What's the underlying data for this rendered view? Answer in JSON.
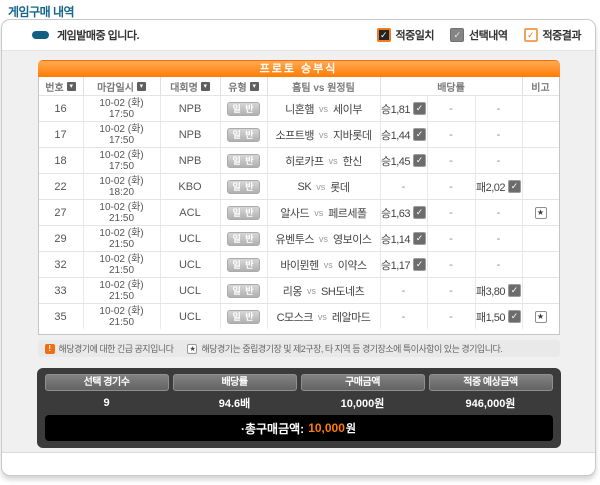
{
  "page": {
    "title": "게임구매 내역"
  },
  "status": {
    "message": "게임발매중 입니다.",
    "legend": [
      {
        "label": "적중일치",
        "style": "dark"
      },
      {
        "label": "선택내역",
        "style": "gray"
      },
      {
        "label": "적중결과",
        "style": "outline"
      }
    ]
  },
  "icons": {
    "check": "✓",
    "star": "★",
    "alert": "!",
    "sort": "▾"
  },
  "table": {
    "title": "프로토 승부식",
    "vs_label": "vs",
    "columns": [
      {
        "label": "번호",
        "sortable": true
      },
      {
        "label": "마감일시",
        "sortable": true
      },
      {
        "label": "대회명",
        "sortable": true
      },
      {
        "label": "유형",
        "sortable": true
      },
      {
        "label": "홈팀 vs 원정팀",
        "sortable": false
      },
      {
        "label": "배당률",
        "sortable": false
      },
      {
        "label": "비고",
        "sortable": false
      }
    ],
    "rows": [
      {
        "no": "16",
        "date": "10-02 (화)",
        "time": "17:50",
        "league": "NPB",
        "type": "일 반",
        "home": "니혼햄",
        "away": "세이부",
        "odds": [
          {
            "text": "승1,81",
            "checked": true
          },
          {
            "text": "-",
            "checked": false
          },
          {
            "text": "-",
            "checked": false
          }
        ],
        "star": false
      },
      {
        "no": "17",
        "date": "10-02 (화)",
        "time": "17:50",
        "league": "NPB",
        "type": "일 반",
        "home": "소프트뱅",
        "away": "지바롯데",
        "odds": [
          {
            "text": "승1,44",
            "checked": true
          },
          {
            "text": "-",
            "checked": false
          },
          {
            "text": "-",
            "checked": false
          }
        ],
        "star": false
      },
      {
        "no": "18",
        "date": "10-02 (화)",
        "time": "17:50",
        "league": "NPB",
        "type": "일 반",
        "home": "히로카프",
        "away": "한신",
        "odds": [
          {
            "text": "승1,45",
            "checked": true
          },
          {
            "text": "-",
            "checked": false
          },
          {
            "text": "-",
            "checked": false
          }
        ],
        "star": false
      },
      {
        "no": "22",
        "date": "10-02 (화)",
        "time": "18:20",
        "league": "KBO",
        "type": "일 반",
        "home": "SK",
        "away": "롯데",
        "odds": [
          {
            "text": "-",
            "checked": false
          },
          {
            "text": "-",
            "checked": false
          },
          {
            "text": "패2,02",
            "checked": true
          }
        ],
        "star": false
      },
      {
        "no": "27",
        "date": "10-02 (화)",
        "time": "21:50",
        "league": "ACL",
        "type": "일 반",
        "home": "알사드",
        "away": "페르세폴",
        "odds": [
          {
            "text": "승1,63",
            "checked": true
          },
          {
            "text": "-",
            "checked": false
          },
          {
            "text": "-",
            "checked": false
          }
        ],
        "star": true
      },
      {
        "no": "29",
        "date": "10-02 (화)",
        "time": "21:50",
        "league": "UCL",
        "type": "일 반",
        "home": "유벤투스",
        "away": "영보이스",
        "odds": [
          {
            "text": "승1,14",
            "checked": true
          },
          {
            "text": "-",
            "checked": false
          },
          {
            "text": "-",
            "checked": false
          }
        ],
        "star": false
      },
      {
        "no": "32",
        "date": "10-02 (화)",
        "time": "21:50",
        "league": "UCL",
        "type": "일 반",
        "home": "바이뮌헨",
        "away": "이약스",
        "odds": [
          {
            "text": "승1,17",
            "checked": true
          },
          {
            "text": "-",
            "checked": false
          },
          {
            "text": "-",
            "checked": false
          }
        ],
        "star": false
      },
      {
        "no": "33",
        "date": "10-02 (화)",
        "time": "21:50",
        "league": "UCL",
        "type": "일 반",
        "home": "리옹",
        "away": "SH도네츠",
        "odds": [
          {
            "text": "-",
            "checked": false
          },
          {
            "text": "-",
            "checked": false
          },
          {
            "text": "패3,80",
            "checked": true
          }
        ],
        "star": false
      },
      {
        "no": "35",
        "date": "10-02 (화)",
        "time": "21:50",
        "league": "UCL",
        "type": "일 반",
        "home": "C모스크",
        "away": "레알마드",
        "odds": [
          {
            "text": "-",
            "checked": false
          },
          {
            "text": "-",
            "checked": false
          },
          {
            "text": "패1,50",
            "checked": true
          }
        ],
        "star": true
      }
    ]
  },
  "notices": [
    {
      "text": "해당경기에 대한 긴급 공지입니다"
    },
    {
      "text": "해당경기는 중립경기장 및 제2구장, 타 지역 등 경기장소에 특이사항이 있는 경기입니다."
    }
  ],
  "summary": {
    "items": [
      {
        "label": "선택 경기수",
        "value": "9"
      },
      {
        "label": "배당률",
        "value": "94.6배"
      },
      {
        "label": "구매금액",
        "value": "10,000원"
      },
      {
        "label": "적중 예상금액",
        "value": "946,000원"
      }
    ],
    "total_label": "·총구매금액:",
    "total_amount": "10,000",
    "total_unit": "원"
  },
  "colors": {
    "accent_orange": "#ff7c02",
    "title_teal": "#15658d",
    "summary_bg": "#3b3b3b",
    "total_amount_orange": "#ff7a00"
  }
}
